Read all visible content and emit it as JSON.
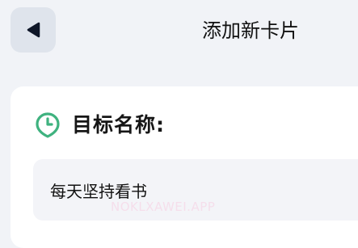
{
  "header": {
    "back_icon": "triangle-left-icon",
    "title": "添加新卡片"
  },
  "form": {
    "goal_name": {
      "icon": "clock-icon",
      "label": "目标名称:",
      "value": "每天坚持看书"
    }
  },
  "watermark": "NOKLXAWEI.APP",
  "colors": {
    "background": "#f1f3f7",
    "back_button_bg": "#dfe4ec",
    "icon_green": "#3fb27f",
    "card_bg": "#ffffff",
    "input_bg": "#f3f4f8"
  }
}
